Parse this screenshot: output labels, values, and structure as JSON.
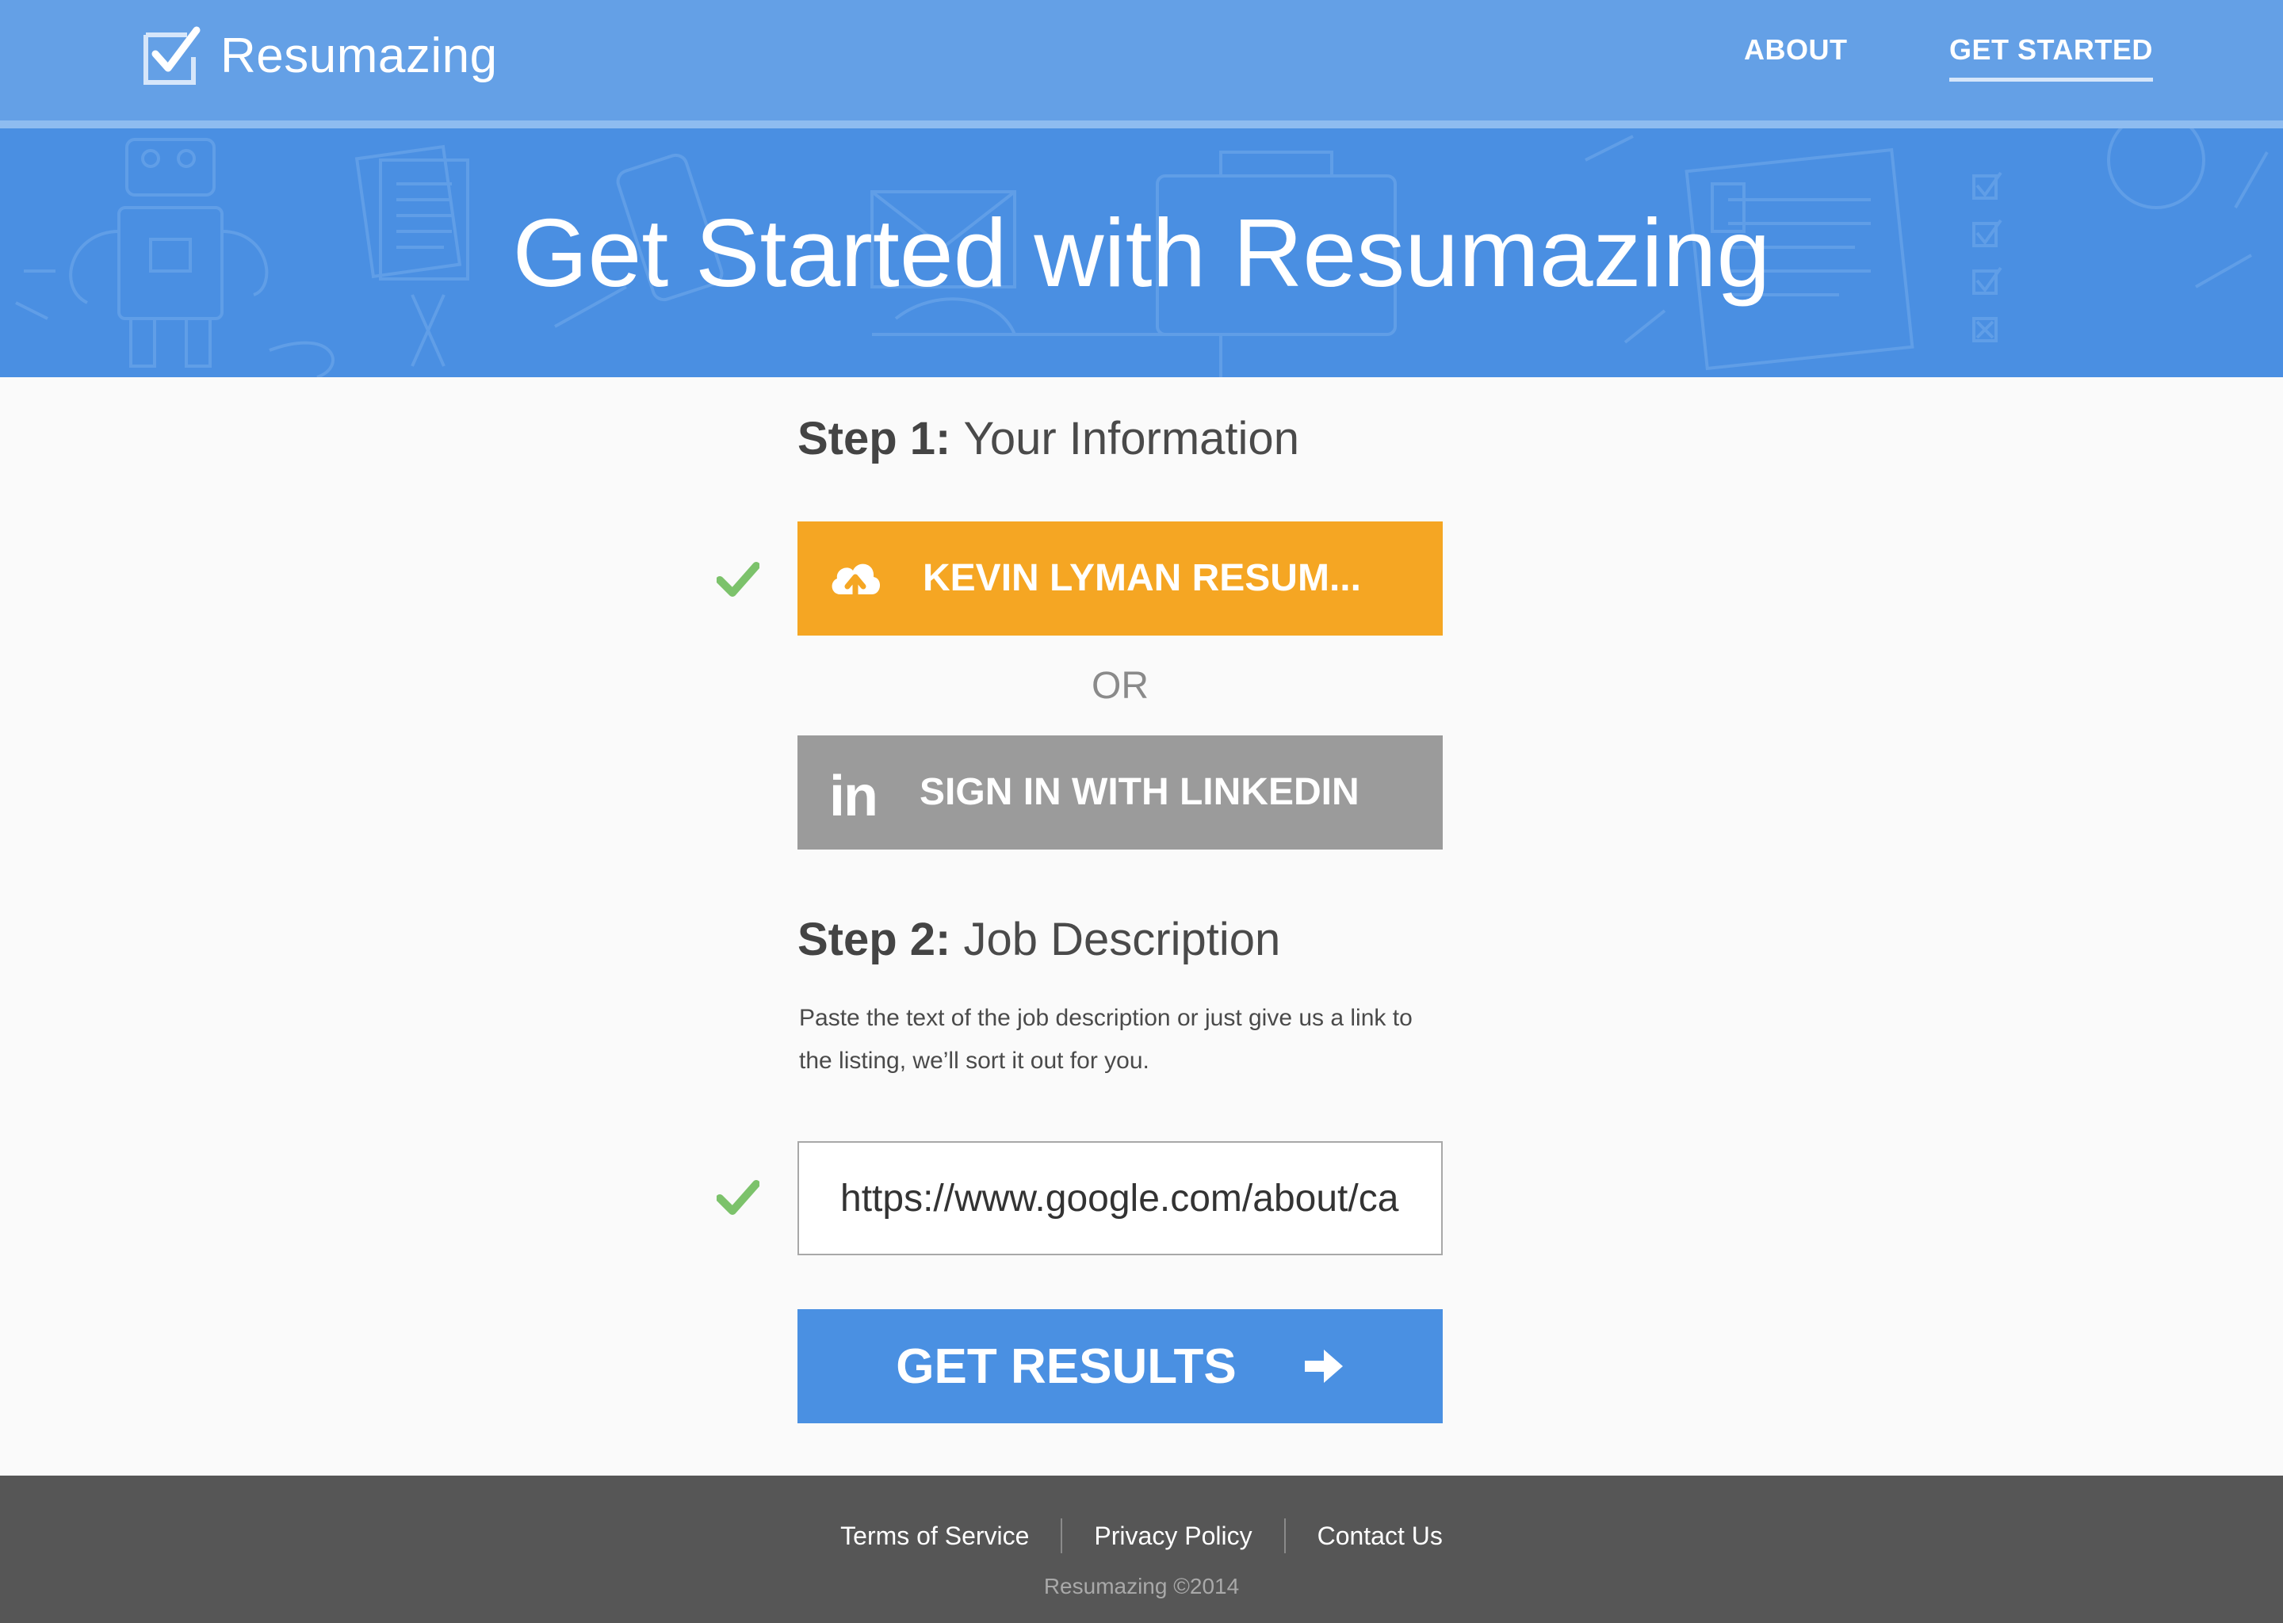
{
  "nav": {
    "brand": "Resumazing",
    "links": [
      "ABOUT",
      "GET STARTED"
    ],
    "active": "GET STARTED"
  },
  "hero": {
    "title": "Get Started with Resumazing"
  },
  "step1": {
    "label": "Step 1:",
    "title": "Your Information",
    "upload_label": "KEVIN LYMAN RESUM...",
    "or_label": "OR",
    "linkedin_label": "SIGN IN WITH LINKEDIN",
    "linkedin_glyph": "in"
  },
  "step2": {
    "label": "Step 2:",
    "title": "Job Description",
    "description_line1": "Paste the text of the  job description or just give us a link to",
    "description_line2": "the listing, we’ll sort it out for you.",
    "url_value": "https://www.google.com/about/ca"
  },
  "submit": {
    "label": "GET RESULTS"
  },
  "footer": {
    "links": [
      "Terms of Service",
      "Privacy Policy",
      "Contact Us"
    ],
    "copyright": "Resumazing ©2014"
  },
  "colors": {
    "nav": "#64a0e6",
    "hero": "#4a8fe2",
    "upload_button": "#f5a623",
    "linkedin_button": "#9b9b9b",
    "submit_button": "#4a90e2",
    "check": "#7cc26b",
    "footer": "#565656"
  },
  "icons": {
    "logo": "checkbox-icon",
    "upload": "cloud-upload-icon",
    "linkedin": "linkedin-icon",
    "submit": "arrow-right-icon",
    "check": "checkmark-icon"
  }
}
